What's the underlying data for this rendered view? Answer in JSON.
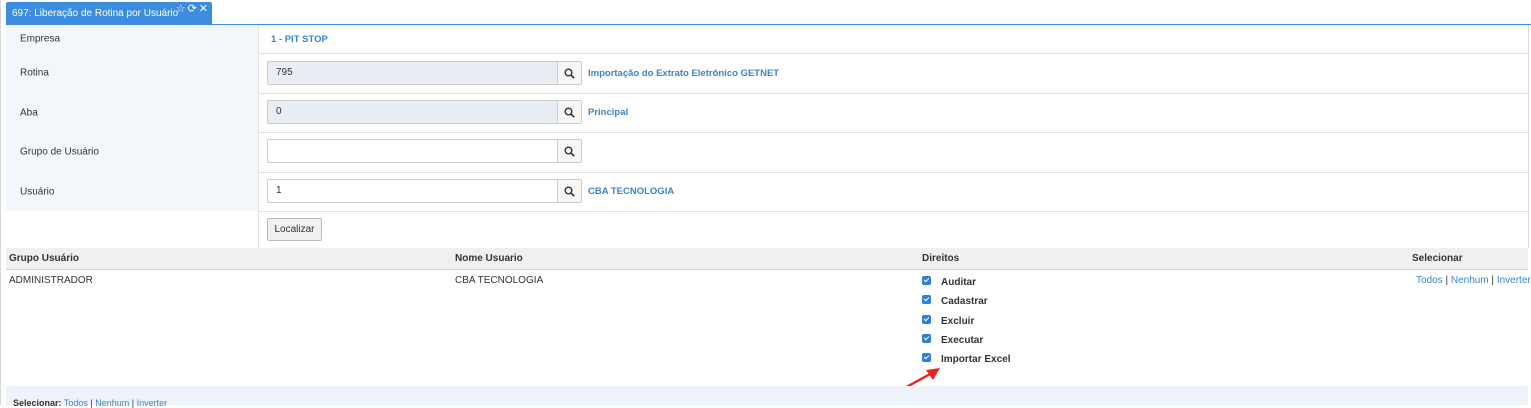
{
  "tab": {
    "title": "697: Liberação de Rotina por Usuário",
    "icons": [
      "star-icon",
      "refresh-icon",
      "close-icon"
    ]
  },
  "form": {
    "empresa": {
      "label": "Empresa",
      "value": "1 - PIT STOP"
    },
    "rotina": {
      "label": "Rotina",
      "value": "795",
      "description": "Importação do Extrato Eletrônico GETNET"
    },
    "aba": {
      "label": "Aba",
      "value": "0",
      "description": "Principal"
    },
    "grupo": {
      "label": "Grupo de Usuário",
      "value": ""
    },
    "usuario": {
      "label": "Usuário",
      "value": "1",
      "description": "CBA TECNOLOGIA"
    },
    "localizar_label": "Localizar"
  },
  "grid": {
    "headers": [
      "Grupo Usuário",
      "Nome Usuario",
      "Direitos",
      "Selecionar"
    ],
    "row": {
      "grupo": "ADMINISTRADOR",
      "nome": "CBA TECNOLOGIA",
      "direitos": [
        {
          "label": "Auditar",
          "checked": true
        },
        {
          "label": "Cadastrar",
          "checked": true
        },
        {
          "label": "Excluir",
          "checked": true
        },
        {
          "label": "Executar",
          "checked": true
        },
        {
          "label": "Importar Excel",
          "checked": true
        }
      ],
      "select_links": [
        "Todos",
        "Nenhum",
        "Inverter"
      ]
    }
  },
  "footer": {
    "label": "Selecionar:",
    "links": [
      "Todos",
      "Nenhum",
      "Inverter"
    ]
  },
  "colors": {
    "accent": "#3c8dde",
    "link": "#3b83c7",
    "arrow": "#e8241a",
    "checkbox": "#2f7ed8"
  }
}
